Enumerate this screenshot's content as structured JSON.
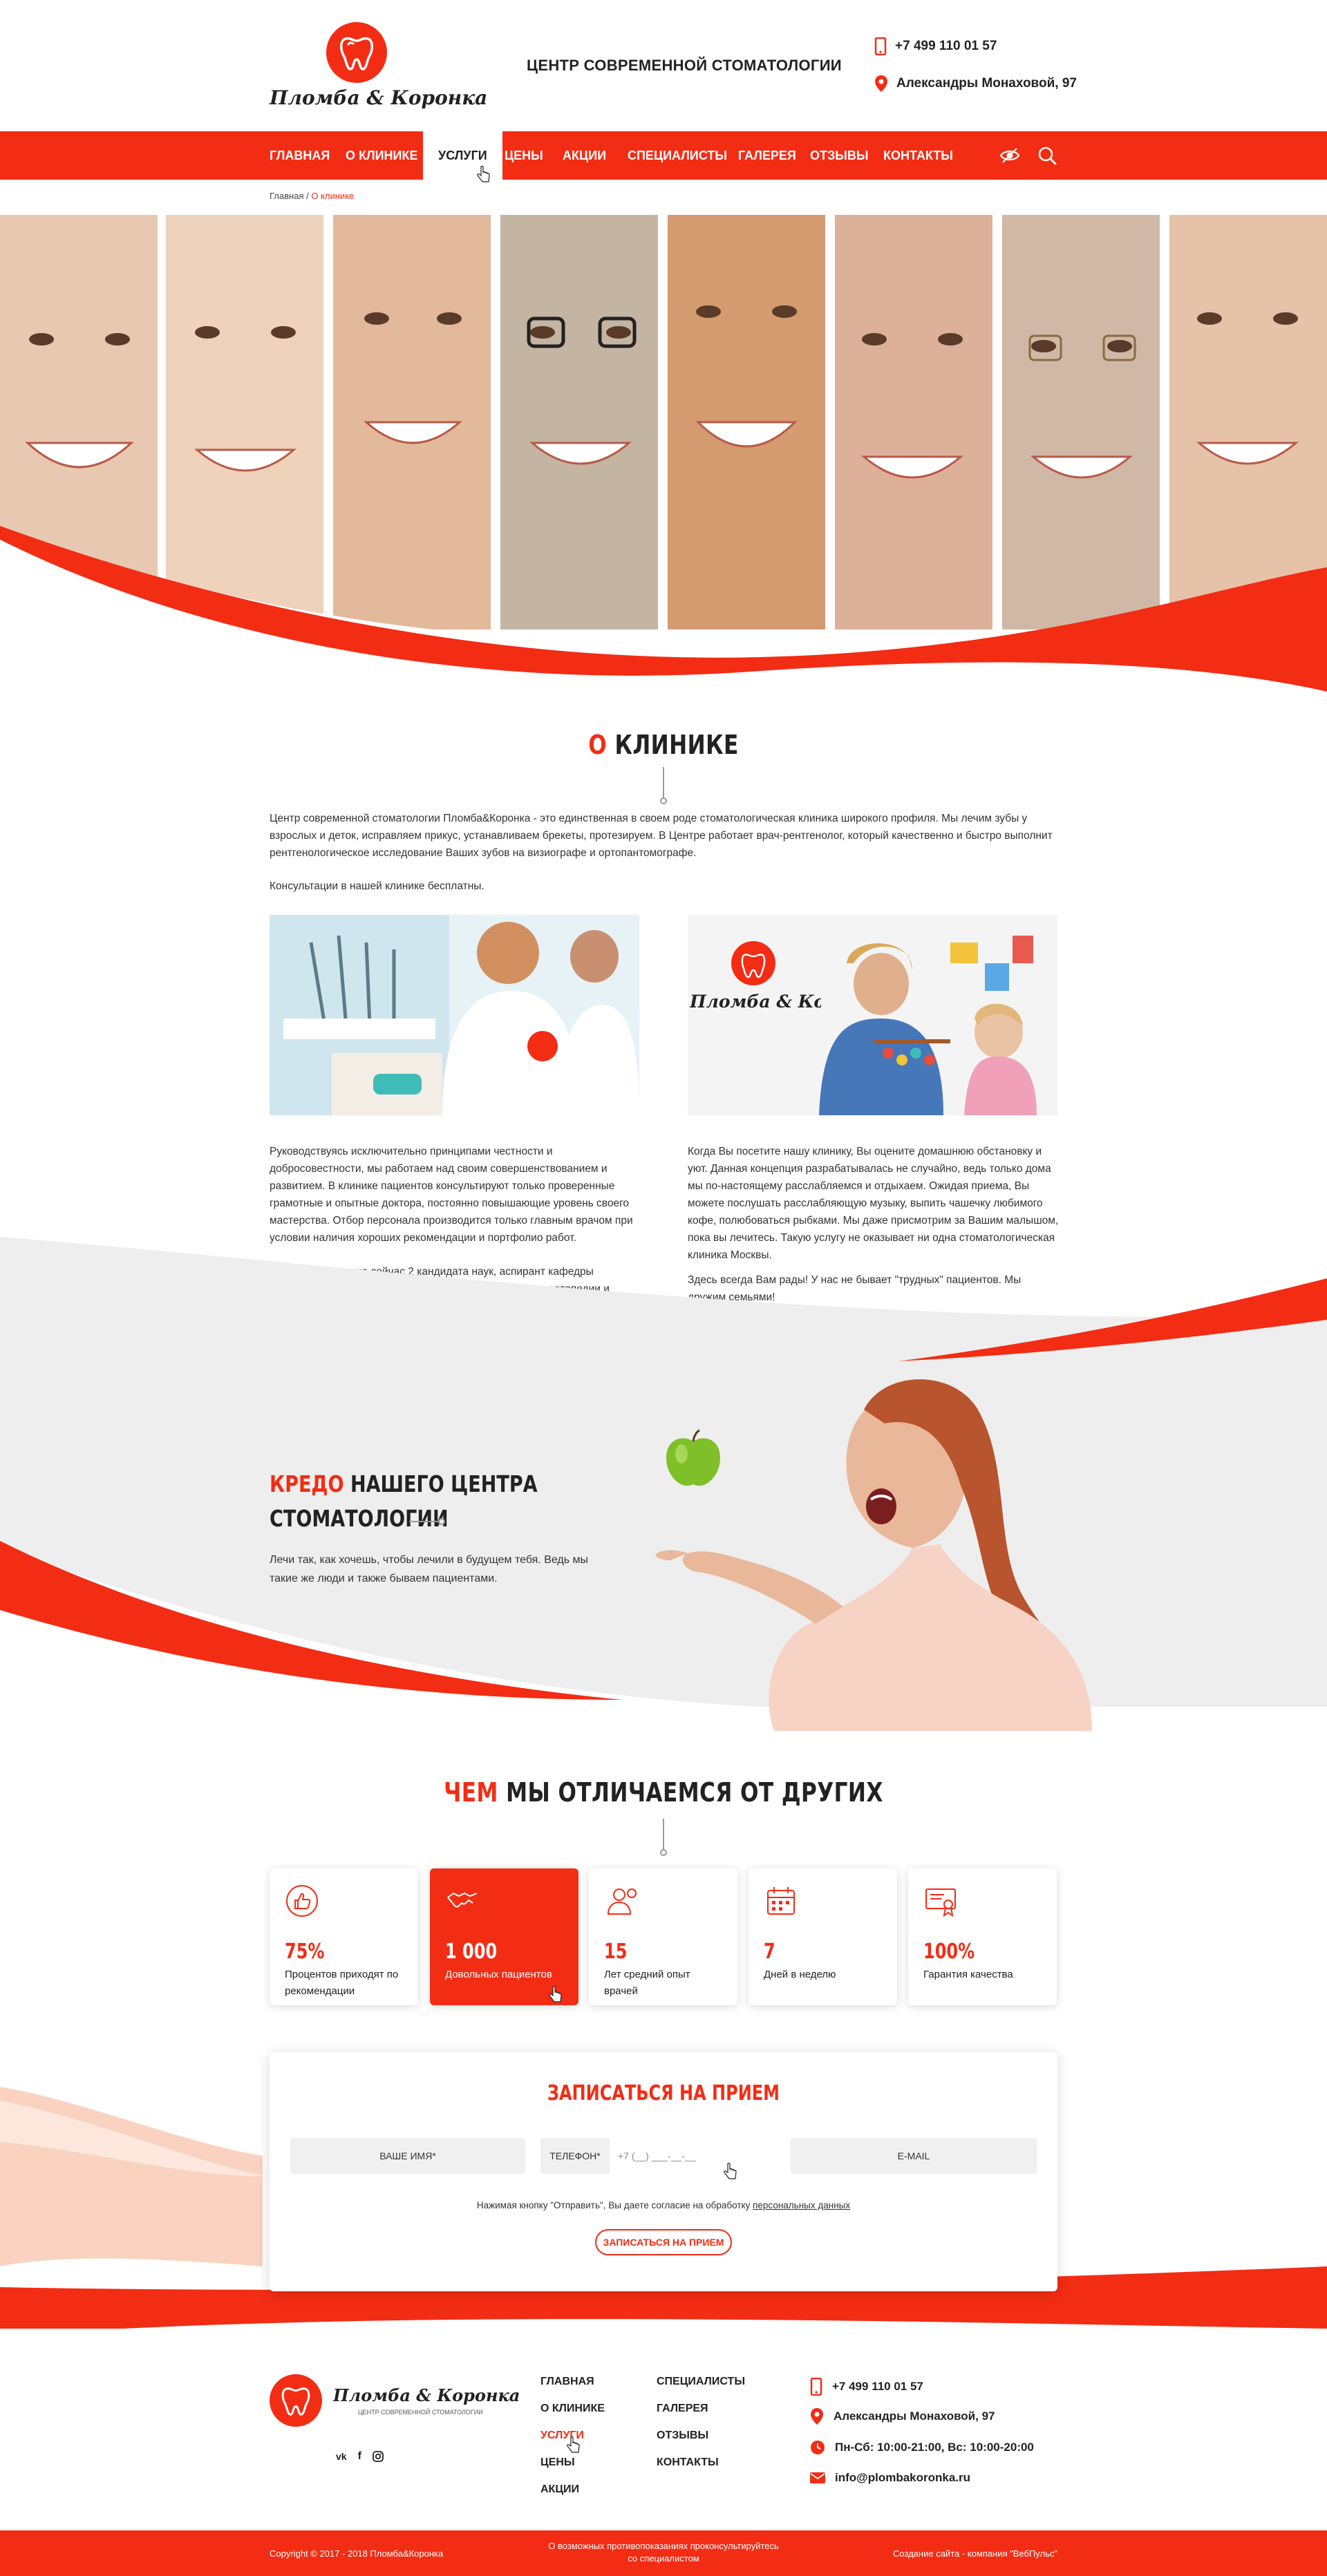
{
  "header": {
    "logo_text": "Пломба & Коронка",
    "tagline": "ЦЕНТР СОВРЕМЕННОЙ СТОМАТОЛОГИИ",
    "phone": "+7 499 110 01 57",
    "address": "Александры Монаховой, 97"
  },
  "nav": {
    "items": [
      "ГЛАВНАЯ",
      "О КЛИНИКЕ",
      "УСЛУГИ",
      "ЦЕНЫ",
      "АКЦИИ",
      "СПЕЦИАЛИСТЫ",
      "ГАЛЕРЕЯ",
      "ОТЗЫВЫ",
      "КОНТАКТЫ"
    ],
    "active": "УСЛУГИ"
  },
  "breadcrumb": {
    "home": "Главная",
    "separator": " / ",
    "current": "О клинике"
  },
  "about": {
    "title_hl": "О",
    "title_rest": " КЛИНИКЕ",
    "intro": "Центр современной стоматологии Пломба&Коронка - это единственная в своем роде стоматологическая клиника широкого профиля. Мы лечим зубы у взрослых и деток, исправляем прикус, устанавливаем брекеты, протезируем. В Центре работает врач-рентгенолог, который качественно и быстро выполнит рентгенологическое исследование Ваших зубов на визиографе и ортопантомографе.",
    "free": "Консультации в нашей клинике бесплатны.",
    "photo_logo": "Пломба & Коронка",
    "left_p1": "Руководствуясь исключительно принципами честности и добросовестности, мы работаем над своим совершенствованием и развитием. В клинике пациентов консультируют только проверенные грамотные и опытные доктора, постоянно повышающие уровень своего мастерства. Отбор персонала производится только главным врачом при условии наличия хороших рекомендации и портфолио работ.",
    "left_p2": "В нашем штате уже сейчас 2 кандидата наук, аспирант кафедры эстетической стоматологии МГМСУ, аспирант кафедры ортопедии и протезирования, врачи высшей категории.",
    "right_p1": "Когда Вы посетите нашу клинику, Вы оцените домашнюю обстановку и уют. Данная концепция разрабатывалась не случайно, ведь только дома мы по-настоящему расслабляемся и отдыхаем. Ожидая приема, Вы можете послушать расслабляющую музыку, выпить чашечку любимого кофе, полюбоваться рыбками. Мы даже присмотрим за Вашим малышом, пока вы лечитесь. Такую услугу не оказывает ни одна стоматологическая клиника Москвы.",
    "right_p2": "Здесь всегда Вам рады! У нас не бывает \"трудных\" пациентов. Мы дружим семьями!"
  },
  "credo": {
    "title_hl": "КРЕДО",
    "title_rest1": " НАШЕГО ЦЕНТРА",
    "title_rest2": "СТОМАТОЛОГИИ",
    "text": "Лечи так, как хочешь, чтобы лечили в будущем тебя. Ведь мы такие же люди и также бываем пациентами."
  },
  "diff": {
    "title_hl": "ЧЕМ",
    "title_rest": " МЫ ОТЛИЧАЕМСЯ ОТ ДРУГИХ",
    "items": [
      {
        "icon": "thumbs-up-icon",
        "num": "75%",
        "label": "Процентов приходят по рекомендации"
      },
      {
        "icon": "handshake-icon",
        "num": "1 000",
        "label": "Довольных пациентов"
      },
      {
        "icon": "doctor-icon",
        "num": "15",
        "label": "Лет средний опыт врачей"
      },
      {
        "icon": "calendar-icon",
        "num": "7",
        "label": "Дней в неделю"
      },
      {
        "icon": "certificate-icon",
        "num": "100%",
        "label": "Гарантия качества"
      }
    ]
  },
  "form": {
    "title": "ЗАПИСАТЬСЯ НА ПРИЕМ",
    "name_placeholder": "ВАШЕ ИМЯ*",
    "phone_label": "ТЕЛЕФОН*",
    "phone_mask": "+7 (__) ___-__-__",
    "email_placeholder": "E-MAIL",
    "consent_pre": "Нажимая кнопку \"Отправить\", Вы даете согласие на обработку ",
    "consent_link": "персональных данных",
    "submit": "ЗАПИСАТЬСЯ НА ПРИЕМ"
  },
  "footer": {
    "logo_text": "Пломба & Коронка",
    "logo_sub": "ЦЕНТР СОВРЕМЕННОЙ СТОМАТОЛОГИИ",
    "social": [
      "vk-icon",
      "facebook-icon",
      "instagram-icon"
    ],
    "col1": [
      "ГЛАВНАЯ",
      "О КЛИНИКЕ",
      "УСЛУГИ",
      "ЦЕНЫ",
      "АКЦИИ"
    ],
    "col2": [
      "СПЕЦИАЛИСТЫ",
      "ГАЛЕРЕЯ",
      "ОТЗЫВЫ",
      "КОНТАКТЫ"
    ],
    "phone": "+7 499 110 01 57",
    "address": "Александры Монаховой, 97",
    "hours": "Пн-Сб: 10:00-21:00, Вс: 10:00-20:00",
    "email": "info@plombakoronka.ru",
    "copyright": "Copyright © 2017 - 2018 Пломба&Коронка",
    "disclaimer_1": "О возможных противопоказаниях проконсультируйтесь",
    "disclaimer_2": "со специалистом",
    "credit": "Создание сайта - компания \"ВебПульс\""
  },
  "colors": {
    "accent": "#f32c14",
    "peach": "#f9d3c0",
    "light_gray": "#eeeeee"
  }
}
